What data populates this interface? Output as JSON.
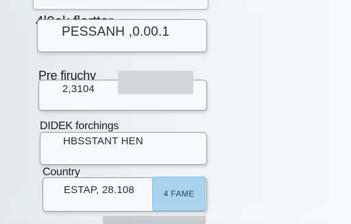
{
  "form": {
    "fields": [
      {
        "label": "4l0ek flertter",
        "value": "PESSANH ,0.00.1"
      },
      {
        "label": "Pre firuchy",
        "value": "2,3104"
      },
      {
        "label": "DIDEK forchings",
        "value": "HBSSTANT HEN"
      },
      {
        "label": "Country",
        "value": "ESTAP, 28.108"
      }
    ],
    "button_label": "4 FAME"
  },
  "colors": {
    "background": "#eef2f4",
    "field_border": "#8f989f",
    "button_fill": "#a5d2ee"
  }
}
